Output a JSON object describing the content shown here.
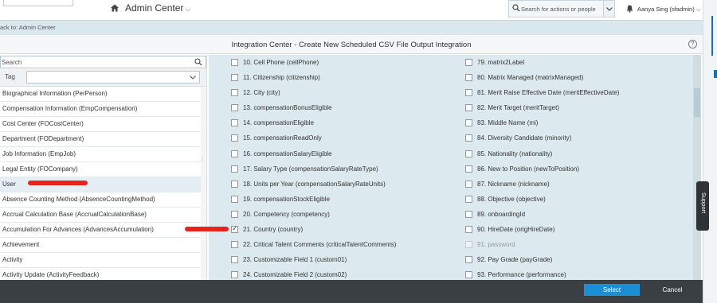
{
  "header": {
    "app_title": "Admin Center",
    "search_placeholder": "Search for actions or people",
    "user_name": "Aanya Sing (sfadmin)"
  },
  "subbar": {
    "back_link": "ack to: Admin Center"
  },
  "dialog": {
    "title": "Integration Center - Create New Scheduled CSV File Output Integration",
    "left_search_placeholder": "Search",
    "tag_label": "Tag",
    "tag_value": "",
    "entities": [
      {
        "label": "Biographical Information (PerPerson)",
        "selected": false
      },
      {
        "label": "Compensation Information (EmpCompensation)",
        "selected": false
      },
      {
        "label": "Cost Center (FOCostCenter)",
        "selected": false
      },
      {
        "label": "Department (FODepartment)",
        "selected": false
      },
      {
        "label": "Job Information (EmpJob)",
        "selected": false
      },
      {
        "label": "Legal Entity (FOCompany)",
        "selected": false
      },
      {
        "label": "User",
        "selected": true
      },
      {
        "label": "Absence Counting Method (AbsenceCountingMethod)",
        "selected": false
      },
      {
        "label": "Accrual Calculation Base (AccrualCalculationBase)",
        "selected": false
      },
      {
        "label": "Accumulation For Advances (AdvancesAccumulation)",
        "selected": false
      },
      {
        "label": "Achievement",
        "selected": false
      },
      {
        "label": "Activity",
        "selected": false
      },
      {
        "label": "Activity Update (ActivityFeedback)",
        "selected": false
      }
    ],
    "fields_left": [
      {
        "label": "10. Cell Phone (cellPhone)",
        "checked": false,
        "disabled": false
      },
      {
        "label": "11. Citizenship (citizenship)",
        "checked": false,
        "disabled": false
      },
      {
        "label": "12. City (city)",
        "checked": false,
        "disabled": false
      },
      {
        "label": "13. compensationBonusEligible",
        "checked": false,
        "disabled": false
      },
      {
        "label": "14. compensationEligible",
        "checked": false,
        "disabled": false
      },
      {
        "label": "15. compensationReadOnly",
        "checked": false,
        "disabled": false
      },
      {
        "label": "16. compensationSalaryEligible",
        "checked": false,
        "disabled": false
      },
      {
        "label": "17. Salary Type (compensationSalaryRateType)",
        "checked": false,
        "disabled": false
      },
      {
        "label": "18. Units per Year (compensationSalaryRateUnits)",
        "checked": false,
        "disabled": false
      },
      {
        "label": "19. compensationStockEligible",
        "checked": false,
        "disabled": false
      },
      {
        "label": "20. Competency (competency)",
        "checked": false,
        "disabled": false
      },
      {
        "label": "21. Country (country)",
        "checked": true,
        "disabled": false
      },
      {
        "label": "22. Critical Talent Comments (criticalTalentComments)",
        "checked": false,
        "disabled": false
      },
      {
        "label": "23. Customizable Field 1 (custom01)",
        "checked": false,
        "disabled": false
      },
      {
        "label": "24. Customizable Field 2 (custom02)",
        "checked": false,
        "disabled": false
      }
    ],
    "fields_right": [
      {
        "label": "79. matrix2Label",
        "checked": false,
        "disabled": false
      },
      {
        "label": "80. Matrix Managed (matrixManaged)",
        "checked": false,
        "disabled": false
      },
      {
        "label": "81. Merit Raise Effective Date (meritEffectiveDate)",
        "checked": false,
        "disabled": false
      },
      {
        "label": "82. Merit Target (meritTarget)",
        "checked": false,
        "disabled": false
      },
      {
        "label": "83. Middle Name (mi)",
        "checked": false,
        "disabled": false
      },
      {
        "label": "84. Diversity Candidate (minority)",
        "checked": false,
        "disabled": false
      },
      {
        "label": "85. Nationality (nationality)",
        "checked": false,
        "disabled": false
      },
      {
        "label": "86. New to Position (newToPosition)",
        "checked": false,
        "disabled": false
      },
      {
        "label": "87. Nickname (nickname)",
        "checked": false,
        "disabled": false
      },
      {
        "label": "88. Objective (objective)",
        "checked": false,
        "disabled": false
      },
      {
        "label": "89. onboardingId",
        "checked": false,
        "disabled": false
      },
      {
        "label": "90. HireDate (origHireDate)",
        "checked": false,
        "disabled": false
      },
      {
        "label": "91. password",
        "checked": false,
        "disabled": true
      },
      {
        "label": "92. Pay Grade (payGrade)",
        "checked": false,
        "disabled": false
      },
      {
        "label": "93. Performance (performance)",
        "checked": false,
        "disabled": false
      }
    ],
    "select_label": "Select",
    "cancel_label": "Cancel"
  },
  "support_label": "Support",
  "colors": {
    "primary_button": "#1a8fd6",
    "footer": "#3a3f44",
    "field_pane": "#dce9ee",
    "annotation": "#e8231c"
  }
}
